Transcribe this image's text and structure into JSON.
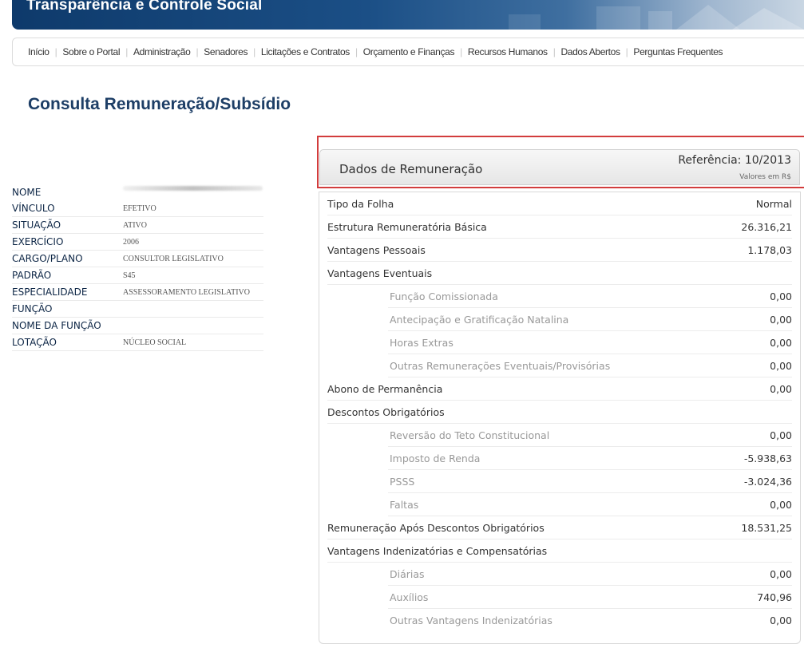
{
  "header": {
    "title": "Transparência e Controle Social"
  },
  "nav": {
    "items": [
      "Início",
      "Sobre o Portal",
      "Administração",
      "Senadores",
      "Licitações e Contratos",
      "Orçamento e Finanças",
      "Recursos Humanos",
      "Dados Abertos",
      "Perguntas Frequentes"
    ]
  },
  "page_title": "Consulta Remuneração/Subsídio",
  "info": {
    "rows": [
      {
        "label": "NOME",
        "value": ""
      },
      {
        "label": "VÍNCULO",
        "value": "EFETIVO"
      },
      {
        "label": "SITUAÇÃO",
        "value": "ATIVO"
      },
      {
        "label": "EXERCÍCIO",
        "value": "2006"
      },
      {
        "label": "CARGO/PLANO",
        "value": "CONSULTOR LEGISLATIVO"
      },
      {
        "label": "PADRÃO",
        "value": "S45"
      },
      {
        "label": "ESPECIALIDADE",
        "value": "ASSESSORAMENTO LEGISLATIVO"
      },
      {
        "label": "FUNÇÃO",
        "value": ""
      },
      {
        "label": "NOME DA FUNÇÃO",
        "value": ""
      },
      {
        "label": "LOTAÇÃO",
        "value": "NÚCLEO SOCIAL"
      }
    ]
  },
  "panel": {
    "title": "Dados de Remuneração",
    "reference": "Referência: 10/2013",
    "unit": "Valores em R$",
    "highlight_color": "#d23c3c",
    "rows": [
      {
        "label": "Tipo da Folha",
        "value": "Normal",
        "sub": false
      },
      {
        "label": "Estrutura Remuneratória Básica",
        "value": "26.316,21",
        "sub": false
      },
      {
        "label": "Vantagens Pessoais",
        "value": "1.178,03",
        "sub": false
      },
      {
        "label": "Vantagens Eventuais",
        "value": "",
        "sub": false
      },
      {
        "label": "Função Comissionada",
        "value": "0,00",
        "sub": true
      },
      {
        "label": "Antecipação e Gratificação Natalina",
        "value": "0,00",
        "sub": true
      },
      {
        "label": "Horas Extras",
        "value": "0,00",
        "sub": true
      },
      {
        "label": "Outras Remunerações Eventuais/Provisórias",
        "value": "0,00",
        "sub": true
      },
      {
        "label": "Abono de Permanência",
        "value": "0,00",
        "sub": false
      },
      {
        "label": "Descontos Obrigatórios",
        "value": "",
        "sub": false
      },
      {
        "label": "Reversão do Teto Constitucional",
        "value": "0,00",
        "sub": true
      },
      {
        "label": "Imposto de Renda",
        "value": "-5.938,63",
        "sub": true
      },
      {
        "label": "PSSS",
        "value": "-3.024,36",
        "sub": true
      },
      {
        "label": "Faltas",
        "value": "0,00",
        "sub": true
      },
      {
        "label": "Remuneração Após Descontos Obrigatórios",
        "value": "18.531,25",
        "sub": false
      },
      {
        "label": "Vantagens Indenizatórias e Compensatórias",
        "value": "",
        "sub": false
      },
      {
        "label": "Diárias",
        "value": "0,00",
        "sub": true
      },
      {
        "label": "Auxílios",
        "value": "740,96",
        "sub": true
      },
      {
        "label": "Outras Vantagens Indenizatórias",
        "value": "0,00",
        "sub": true
      }
    ]
  }
}
